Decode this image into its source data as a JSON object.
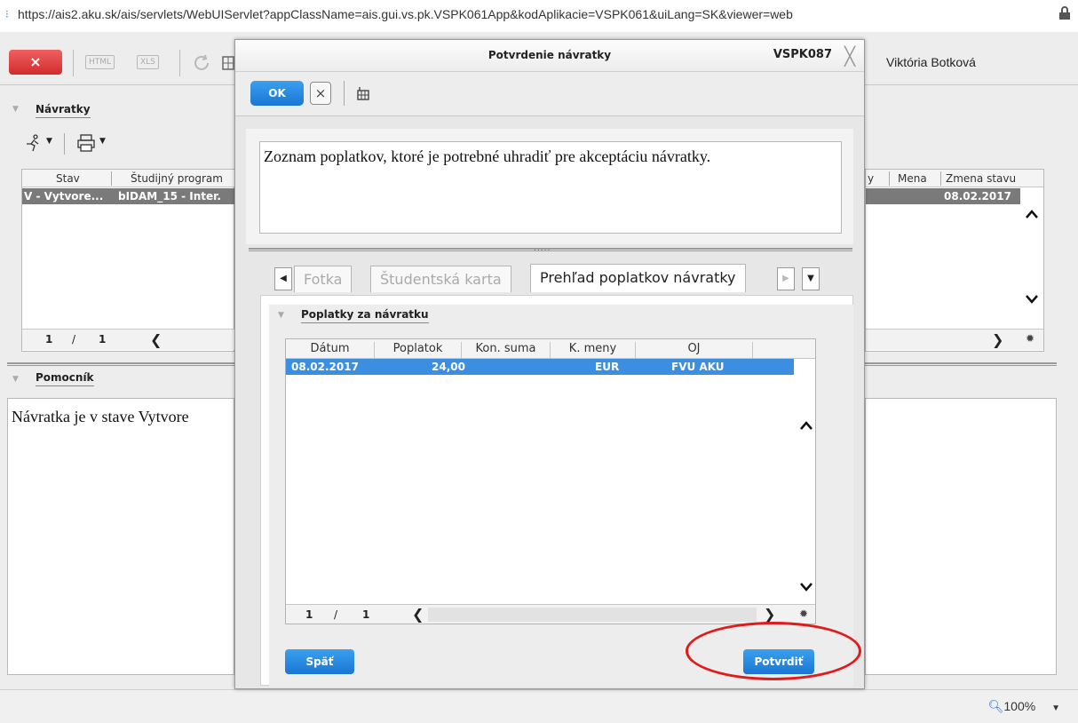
{
  "browser": {
    "url": "https://ais2.aku.sk/ais/servlets/WebUIServlet?appClassName=ais.gui.vs.pk.VSPK061App&kodAplikacie=VSPK061&uiLang=SK&viewer=web"
  },
  "app": {
    "close_label": "×",
    "html_label": "HTML",
    "xls_label": "XLS",
    "user_name": "Viktória Botková"
  },
  "navratky": {
    "title": "Návratky",
    "columns": [
      "Stav",
      "Študijný program",
      "y",
      "Mena",
      "Zmena stavu"
    ],
    "row": {
      "stav": "V - Vytvore...",
      "program": "bIDAM_15 - Inter.",
      "zmena": "08.02.2017"
    },
    "pager": {
      "current": "1",
      "sep": "/",
      "total": "1"
    }
  },
  "pomocnik": {
    "title": "Pomocník",
    "text": "Návratka je v stave Vytvore"
  },
  "modal": {
    "title": "Potvrdenie návratky",
    "code": "VSPK087",
    "ok_label": "OK",
    "cancel_label": "×",
    "description": "Zoznam poplatkov, ktoré je potrebné uhradiť pre akceptáciu návratky.",
    "splitter_dots": ".....",
    "tabs": [
      {
        "label": "Fotka",
        "active": false
      },
      {
        "label": "Študentská karta",
        "active": false
      },
      {
        "label": "Prehľad poplatkov návratky",
        "active": true
      }
    ],
    "panel_title": "Poplatky za návratku",
    "fee_columns": [
      "Dátum",
      "Poplatok",
      "Kon. suma",
      "K. meny",
      "OJ"
    ],
    "fee_rows": [
      {
        "datum": "08.02.2017",
        "poplatok": "24,00",
        "kon_suma": "",
        "k_meny": "EUR",
        "oj": "FVU AKU"
      }
    ],
    "pager": {
      "current": "1",
      "sep": "/",
      "total": "1"
    },
    "back_label": "Späť",
    "confirm_label": "Potvrdiť"
  },
  "status": {
    "zoom": "100%"
  },
  "colors": {
    "accent": "#1a76d2",
    "selected_row": "#3c8fe0",
    "highlight": "#e01b1b",
    "close_button": "#d22c2c"
  }
}
